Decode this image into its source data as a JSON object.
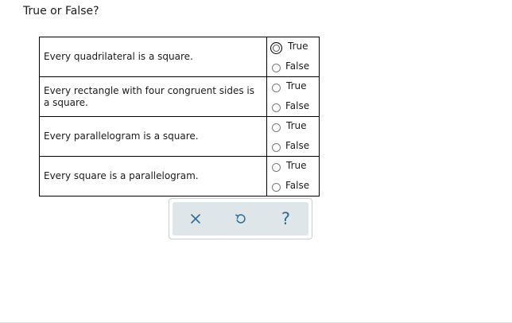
{
  "prompt": "True or False?",
  "questions": [
    {
      "statement": "Every quadrilateral is a square.",
      "options": [
        "True",
        "False"
      ],
      "selected": null,
      "focused_option": "True"
    },
    {
      "statement": "Every rectangle with four congruent sides is a square.",
      "options": [
        "True",
        "False"
      ],
      "selected": null
    },
    {
      "statement": "Every parallelogram is a square.",
      "options": [
        "True",
        "False"
      ],
      "selected": null
    },
    {
      "statement": "Every square is a parallelogram.",
      "options": [
        "True",
        "False"
      ],
      "selected": null
    }
  ],
  "toolbar": {
    "buttons": [
      {
        "icon": "close-icon",
        "glyph": "✕"
      },
      {
        "icon": "undo-icon",
        "glyph": "↺"
      },
      {
        "icon": "help-icon",
        "glyph": "?"
      }
    ],
    "accent_color": "#2c6e91",
    "background_color": "#dfe6ea"
  }
}
